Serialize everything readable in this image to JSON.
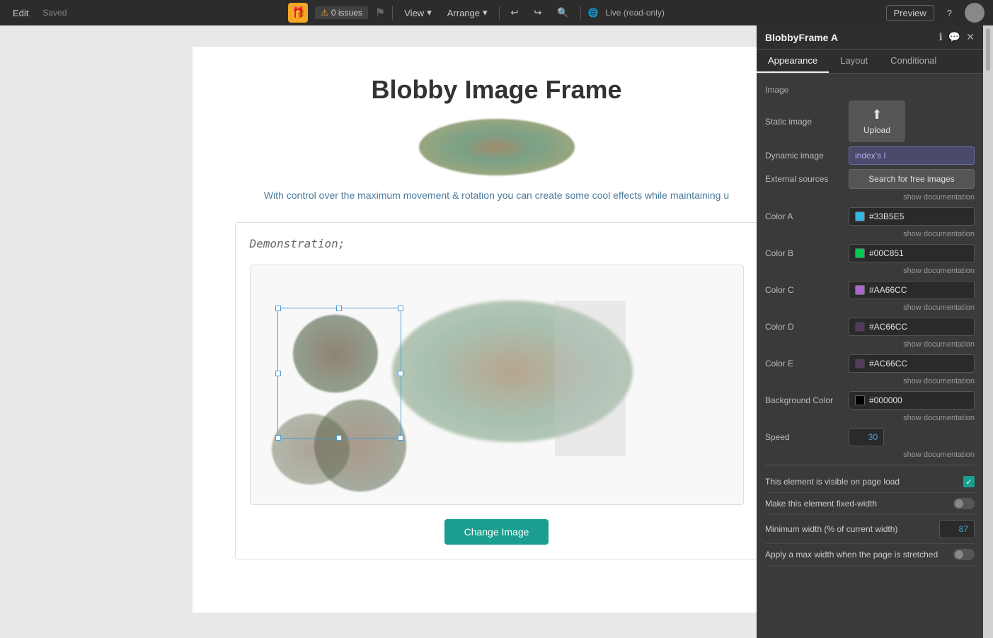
{
  "topbar": {
    "edit_label": "Edit",
    "saved_label": "Saved",
    "gift_icon": "🎁",
    "issues_label": "0 issues",
    "view_label": "View",
    "arrange_label": "Arrange",
    "live_label": "Live (read-only)",
    "preview_label": "Preview",
    "help_icon": "?",
    "undo_icon": "↩",
    "redo_icon": "↪",
    "search_icon": "🔍"
  },
  "canvas": {
    "page_title": "Blobby Image Frame",
    "subtitle": "With control over the maximum movement & rotation you can create some cool effects while maintaining u",
    "demo_label": "Demonstration;",
    "change_image_btn": "Change Image"
  },
  "panel": {
    "title": "BlobbyFrame A",
    "tabs": [
      "Appearance",
      "Layout",
      "Conditional"
    ],
    "active_tab": "Appearance",
    "sections": {
      "image_label": "Image",
      "static_image_label": "Static image",
      "upload_label": "Upload",
      "dynamic_image_label": "Dynamic image",
      "dynamic_image_value": "index's I",
      "external_sources_label": "External sources",
      "search_placeholder": "Search for free images",
      "show_doc": "show documentation"
    },
    "colors": {
      "color_a_label": "Color A",
      "color_a_value": "#33B5E5",
      "color_a_hex": "#33B5E5",
      "color_b_label": "Color B",
      "color_b_value": "#00C851",
      "color_b_hex": "#00C851",
      "color_c_label": "Color C",
      "color_c_value": "#AA66CC",
      "color_c_hex": "#AA66CC",
      "color_d_label": "Color D",
      "color_d_value": "#AC66CC",
      "color_d_hex": "#AC66CC",
      "color_e_label": "Color E",
      "color_e_value": "#AC66CC",
      "color_e_hex": "#AC66CC",
      "bg_color_label": "Background Color",
      "bg_color_value": "#000000",
      "bg_color_hex": "#000000"
    },
    "speed": {
      "label": "Speed",
      "value": "30"
    },
    "checkboxes": {
      "visible_on_load": "This element is visible on page load",
      "visible_on_load_checked": true,
      "fixed_width": "Make this element fixed-width",
      "fixed_width_checked": false,
      "min_width_label": "Minimum width (% of current width)",
      "min_width_value": "87",
      "max_width": "Apply a max width when the page is stretched",
      "max_width_checked": false
    }
  }
}
